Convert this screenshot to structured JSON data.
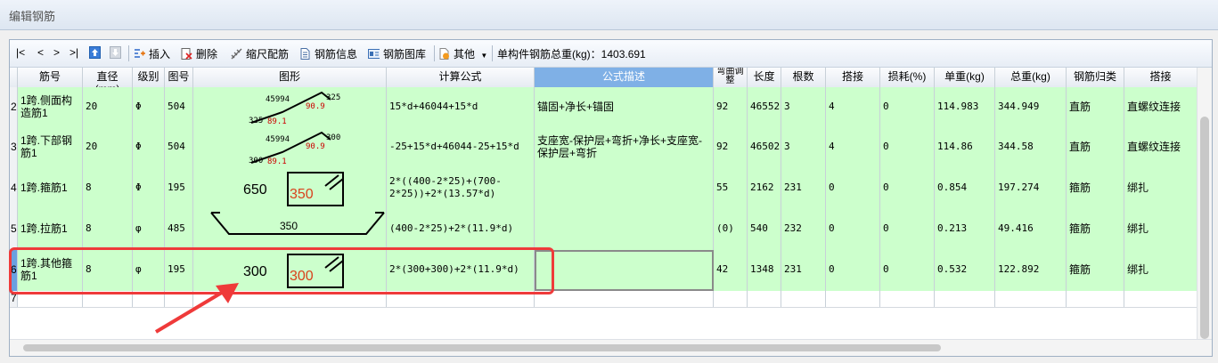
{
  "window": {
    "title": "编辑钢筋"
  },
  "toolbar": {
    "nav": [
      "|<",
      "<",
      ">",
      ">|"
    ],
    "insert": "插入",
    "delete": "删除",
    "scale": "缩尺配筋",
    "info": "钢筋信息",
    "library": "钢筋图库",
    "other": "其他",
    "total_weight": "单构件钢筋总重(kg)：1403.691"
  },
  "columns": [
    "筋号",
    "直径(mm)",
    "级别",
    "图号",
    "图形",
    "计算公式",
    "公式描述",
    "弯曲调整",
    "长度",
    "根数",
    "搭接",
    "损耗(%)",
    "单重(kg)",
    "总重(kg)",
    "钢筋归类",
    "搭接"
  ],
  "rows": [
    {
      "num": "2",
      "name": "1跨.侧面构造筋1",
      "dia": "20",
      "grade": "Φ",
      "fig": "504",
      "formula": "15*d+46044+15*d",
      "desc": "锚固+净长+锚固",
      "bend": "92",
      "len": "46552",
      "count": "3",
      "lap": "4",
      "loss": "0",
      "unit": "114.983",
      "total": "344.949",
      "type": "直筋",
      "conn": "直螺纹连接",
      "shape": {
        "a": "45994",
        "b": "325",
        "c": "325",
        "d": "90.9",
        "e": "89.1"
      }
    },
    {
      "num": "3",
      "name": "1跨.下部钢筋1",
      "dia": "20",
      "grade": "Φ",
      "fig": "504",
      "formula": "-25+15*d+46044-25+15*d",
      "desc": "支座宽-保护层+弯折+净长+支座宽-保护层+弯折",
      "bend": "92",
      "len": "46502",
      "count": "3",
      "lap": "4",
      "loss": "0",
      "unit": "114.86",
      "total": "344.58",
      "type": "直筋",
      "conn": "直螺纹连接",
      "shape": {
        "a": "45994",
        "b": "300",
        "c": "300",
        "d": "90.9",
        "e": "89.1"
      }
    },
    {
      "num": "4",
      "name": "1跨.箍筋1",
      "dia": "8",
      "grade": "Φ",
      "fig": "195",
      "formula": "2*((400-2*25)+(700-2*25))+2*(13.57*d)",
      "desc": "",
      "bend": "55",
      "len": "2162",
      "count": "231",
      "lap": "0",
      "loss": "0",
      "unit": "0.854",
      "total": "197.274",
      "type": "箍筋",
      "conn": "绑扎",
      "shape": {
        "w": "650",
        "h": "350"
      }
    },
    {
      "num": "5",
      "name": "1跨.拉筋1",
      "dia": "8",
      "grade": "φ",
      "fig": "485",
      "formula": "(400-2*25)+2*(11.9*d)",
      "desc": "",
      "bend": "(0)",
      "len": "540",
      "count": "232",
      "lap": "0",
      "loss": "0",
      "unit": "0.213",
      "total": "49.416",
      "type": "箍筋",
      "conn": "绑扎",
      "shape": {
        "w": "350"
      }
    },
    {
      "num": "6",
      "name": "1跨.其他箍筋1",
      "dia": "8",
      "grade": "φ",
      "fig": "195",
      "formula": "2*(300+300)+2*(11.9*d)",
      "desc": "",
      "bend": "42",
      "len": "1348",
      "count": "231",
      "lap": "0",
      "loss": "0",
      "unit": "0.532",
      "total": "122.892",
      "type": "箍筋",
      "conn": "绑扎",
      "shape": {
        "w": "300",
        "h": "300"
      }
    }
  ],
  "empty_row": "7",
  "colors": {
    "row_bg": "#ccffcc",
    "highlight": "#ef3a3a",
    "header_active": "#7fb0e6"
  }
}
